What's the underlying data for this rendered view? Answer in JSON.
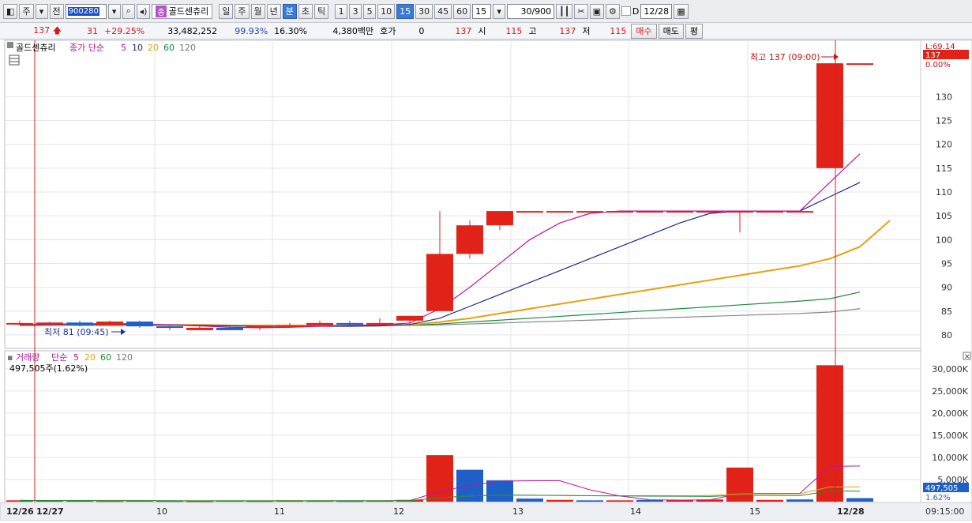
{
  "toolbar": {
    "period_tab": "주",
    "prev_label": "전",
    "stock_code": "900280",
    "stock_badge": "종",
    "stock_name": "골드센츄리",
    "intervals": [
      "일",
      "주",
      "월",
      "년",
      "분",
      "초",
      "틱"
    ],
    "selected_interval": "분",
    "minutes": [
      "1",
      "3",
      "5",
      "10",
      "15",
      "30",
      "45",
      "60"
    ],
    "selected_minute": "15",
    "minute_select": "15",
    "count": "30/900",
    "date": "12/28",
    "d_checkbox_label": "D"
  },
  "quote": {
    "price": "137",
    "change": "31",
    "change_pct": "+29.25%",
    "volume": "33,482,252",
    "ratio": "99.93%",
    "turnover": "16.30%",
    "amount": "4,380백만",
    "hoga_label": "호가",
    "hoga_value": "0",
    "hoga_price": "137",
    "open_label": "시",
    "open_value": "115",
    "high_label": "고",
    "high_value": "137",
    "low_label": "저",
    "low_value": "115",
    "buy_label": "매수",
    "sell_label": "매도",
    "avg_label": "평"
  },
  "price_panel": {
    "stock_label": "골드센츄리",
    "ma_legend_prefix": "종가 단순",
    "ma_periods": [
      "5",
      "10",
      "20",
      "60",
      "120"
    ],
    "ma_colors": [
      "#c0129f",
      "#1a2a8c",
      "#e8a10c",
      "#198a3a",
      "#777777"
    ],
    "top_right_label": "L:69.14",
    "current_price_tag": "137",
    "current_pct_tag": "0.00%",
    "high_annotation": "최고 137 (09:00)",
    "low_annotation": "최저 81 (09:45)",
    "y_ticks": [
      "130",
      "125",
      "120",
      "115",
      "110",
      "105",
      "100",
      "95",
      "90",
      "85",
      "80"
    ]
  },
  "volume_panel": {
    "label": "거래량",
    "ma_legend_prefix": "단순",
    "ma_periods": [
      "5",
      "20",
      "60",
      "120"
    ],
    "current_volume": "497,505주(1.62%)",
    "current_volume_tag": "497,505",
    "current_pct_tag": "1.62%",
    "y_ticks": [
      "30,000K",
      "25,000K",
      "20,000K",
      "15,000K",
      "10,000K",
      "5,000K"
    ]
  },
  "x_axis": {
    "labels": [
      "12/26",
      "12/27",
      "10",
      "11",
      "12",
      "13",
      "14",
      "15",
      "12/28"
    ],
    "time_label": "09:15:00"
  },
  "chart_data": {
    "type": "candlestick",
    "y_range": [
      78,
      141
    ],
    "volume_range": [
      0,
      33000
    ],
    "candles": [
      {
        "o": 82.5,
        "h": 83,
        "l": 82,
        "c": 82.5,
        "up": true
      },
      {
        "o": 82.5,
        "h": 82.8,
        "l": 82,
        "c": 82.6,
        "up": true
      },
      {
        "o": 82.6,
        "h": 83,
        "l": 81.8,
        "c": 82,
        "up": false
      },
      {
        "o": 82,
        "h": 83,
        "l": 82,
        "c": 82.8,
        "up": true
      },
      {
        "o": 82.8,
        "h": 83,
        "l": 81.5,
        "c": 81.8,
        "up": false
      },
      {
        "o": 81.8,
        "h": 82,
        "l": 81,
        "c": 81.5,
        "up": false
      },
      {
        "o": 81.5,
        "h": 82,
        "l": 81,
        "c": 81,
        "up": true
      },
      {
        "o": 81.5,
        "h": 82,
        "l": 81,
        "c": 81,
        "up": false
      },
      {
        "o": 81.5,
        "h": 82,
        "l": 81,
        "c": 81.8,
        "up": true
      },
      {
        "o": 81.8,
        "h": 82.5,
        "l": 81.5,
        "c": 82,
        "up": true
      },
      {
        "o": 82,
        "h": 83,
        "l": 81.8,
        "c": 82.5,
        "up": true
      },
      {
        "o": 82.5,
        "h": 83,
        "l": 82,
        "c": 82.2,
        "up": false
      },
      {
        "o": 82.2,
        "h": 83.5,
        "l": 82,
        "c": 82.5,
        "up": true
      },
      {
        "o": 83,
        "h": 84,
        "l": 82,
        "c": 84,
        "up": true
      },
      {
        "o": 85,
        "h": 106,
        "l": 85,
        "c": 97,
        "up": true
      },
      {
        "o": 97,
        "h": 104,
        "l": 96,
        "c": 103,
        "up": true
      },
      {
        "o": 103,
        "h": 106,
        "l": 102,
        "c": 106,
        "up": true
      },
      {
        "o": 106,
        "h": 106,
        "l": 106,
        "c": 106,
        "up": true
      },
      {
        "o": 106,
        "h": 106,
        "l": 106,
        "c": 106,
        "up": true
      },
      {
        "o": 106,
        "h": 106,
        "l": 106,
        "c": 106,
        "up": true
      },
      {
        "o": 106,
        "h": 106,
        "l": 106,
        "c": 106,
        "up": true
      },
      {
        "o": 106,
        "h": 106,
        "l": 106,
        "c": 106,
        "up": true
      },
      {
        "o": 106,
        "h": 106,
        "l": 106,
        "c": 106,
        "up": true
      },
      {
        "o": 106,
        "h": 106,
        "l": 106,
        "c": 106,
        "up": true
      },
      {
        "o": 106,
        "h": 106,
        "l": 101.5,
        "c": 106,
        "up": true
      },
      {
        "o": 106,
        "h": 106,
        "l": 106,
        "c": 106,
        "up": true
      },
      {
        "o": 106,
        "h": 106,
        "l": 106,
        "c": 106,
        "up": true
      },
      {
        "o": 115,
        "h": 137,
        "l": 115,
        "c": 137,
        "up": true
      },
      {
        "o": 137,
        "h": 137,
        "l": 137,
        "c": 137,
        "up": true
      }
    ],
    "volumes": [
      300,
      200,
      250,
      150,
      200,
      150,
      120,
      200,
      150,
      300,
      200,
      150,
      200,
      400,
      10500,
      7200,
      4800,
      700,
      400,
      300,
      300,
      400,
      400,
      500,
      7700,
      400,
      500,
      30800,
      800
    ],
    "volume_up": [
      true,
      true,
      false,
      true,
      false,
      false,
      true,
      false,
      true,
      true,
      true,
      false,
      true,
      true,
      true,
      false,
      false,
      false,
      true,
      false,
      true,
      false,
      true,
      true,
      true,
      true,
      false,
      true,
      false
    ],
    "ma5": [
      82.2,
      82.3,
      82.3,
      82.4,
      82.3,
      82.1,
      81.9,
      81.6,
      81.5,
      81.6,
      81.8,
      82,
      82.1,
      82.5,
      85.5,
      90,
      95,
      100,
      103.5,
      105.5,
      106,
      106,
      106,
      106,
      106,
      106,
      106,
      112,
      118
    ],
    "ma10": [
      82.1,
      82.2,
      82.2,
      82.2,
      82.2,
      82.1,
      82,
      81.9,
      81.8,
      81.8,
      81.8,
      81.8,
      81.9,
      82.2,
      83.5,
      86,
      88.5,
      91,
      93.5,
      96,
      98.5,
      101,
      103.5,
      105.5,
      106,
      106,
      106,
      109,
      112
    ],
    "ma20": [
      82,
      82,
      82.1,
      82.1,
      82.1,
      82.1,
      82.1,
      82,
      82,
      82,
      82,
      82,
      82,
      82.1,
      82.7,
      83.5,
      84.5,
      85.5,
      86.5,
      87.5,
      88.5,
      89.5,
      90.5,
      91.5,
      92.5,
      93.5,
      94.5,
      96,
      98.5,
      104
    ],
    "ma60": [
      82,
      82,
      82,
      82,
      82,
      82,
      82,
      82,
      82,
      82,
      82,
      82,
      82,
      82,
      82.3,
      82.7,
      83.1,
      83.5,
      83.9,
      84.3,
      84.7,
      85.1,
      85.5,
      85.9,
      86.3,
      86.7,
      87.1,
      87.6,
      89
    ],
    "ma120": [
      82,
      82,
      82,
      82,
      82,
      82,
      82,
      82,
      82,
      82,
      82,
      82,
      82,
      82,
      82.1,
      82.3,
      82.5,
      82.7,
      82.9,
      83.1,
      83.3,
      83.5,
      83.7,
      83.9,
      84.1,
      84.3,
      84.5,
      84.8,
      85.5
    ]
  }
}
